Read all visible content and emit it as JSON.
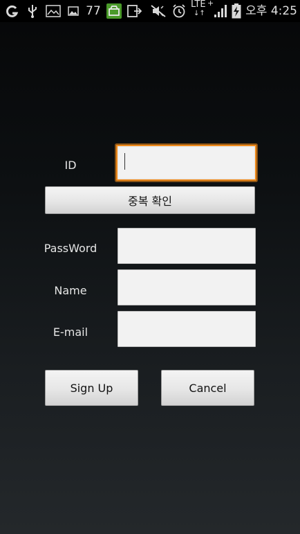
{
  "status_bar": {
    "icons": [
      "g-app-icon",
      "usb-icon",
      "image-notification-icon",
      "photo-notification-icon",
      "download-notification-icon",
      "share-icon",
      "mute-icon",
      "alarm-icon",
      "lte-data-icon",
      "signal-icon",
      "battery-charging-icon"
    ],
    "badge_count": "77",
    "network": "LTE",
    "time": "오후 4:25",
    "colors": {
      "background": "#000000",
      "icon": "#d8d8d8",
      "highlight": "#4a9a2a"
    }
  },
  "form": {
    "id_label": "ID",
    "id_value": "",
    "check_button_label": "중복 확인",
    "password_label": "PassWord",
    "password_value": "",
    "name_label": "Name",
    "name_value": "",
    "email_label": "E-mail",
    "email_value": ""
  },
  "actions": {
    "signup_label": "Sign Up",
    "cancel_label": "Cancel"
  },
  "colors": {
    "focus_border": "#f08a1a",
    "field_background": "#f2f2f2",
    "button_background": "#e6e6e6"
  }
}
